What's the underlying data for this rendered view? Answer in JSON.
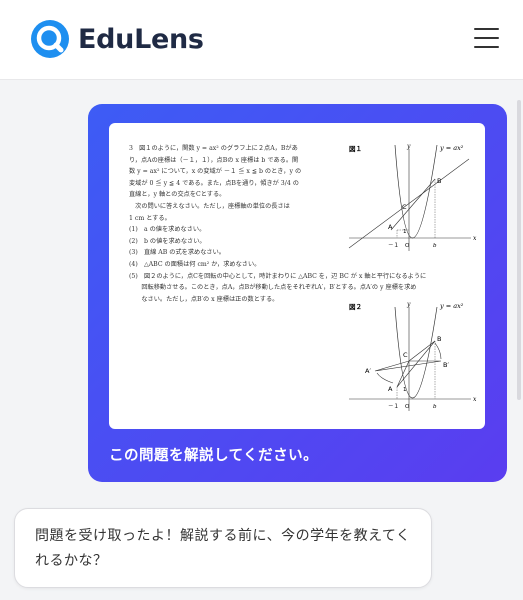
{
  "header": {
    "brand": "EduLens"
  },
  "problem": {
    "lines": [
      "3　図１のように，関数 y = ax² のグラフ上に２点A，Bがあ",
      "り，点Aの座標は（－１，１），点Bの x 座標は b である。関",
      "数 y = ax² について，x の変域が －１ ≦ x ≦ b のとき，y の",
      "変域が 0 ≦ y ≦ 4 である。また，点Bを通り，傾きが 3/4 の",
      "直線と，y 軸との交点をCとする。",
      "　次の問いに答えなさい。ただし，座標軸の単位の長さは",
      "1 cm とする。",
      "(1)　a の値を求めなさい。",
      "(2)　b の値を求めなさい。",
      "(3)　直線 AB の式を求めなさい。",
      "(4)　△ABC の面積は何 cm² か，求めなさい。",
      "(5)　図２のように，点Cを回転の中心として，時計まわりに △ABC を，辺 BC が x 軸と平行になるように",
      "　　回転移動させる。このとき，点A，点Bが移動した点をそれぞれA′，B′とする。点A′の y 座標を求め",
      "　　なさい。ただし，点B′の x 座標は正の数とする。"
    ],
    "fig1": {
      "title": "図１",
      "formula": "y = ax²",
      "axis_y": "y",
      "axis_x": "x",
      "origin": "O",
      "point_a": "A",
      "point_b": "B",
      "point_c": "C",
      "tick_neg1": "－１",
      "tick_b": "b",
      "tick_1": "1"
    },
    "fig2": {
      "title": "図２",
      "formula": "y = ax²",
      "axis_y": "y",
      "axis_x": "x",
      "origin": "O",
      "point_a": "A",
      "point_b": "B",
      "point_c": "C",
      "point_a2": "A′",
      "point_b2": "B′",
      "tick_neg1": "－１",
      "tick_b": "b",
      "tick_1": "1"
    }
  },
  "chat": {
    "user_message": "この問題を解説してください。",
    "bot_message": "問題を受け取ったよ！解説する前に、今の学年を教えてくれるかな？"
  },
  "colors": {
    "accent_start": "#3d5cf5",
    "accent_end": "#5a3df0",
    "logo_blue": "#1e8ff0"
  }
}
